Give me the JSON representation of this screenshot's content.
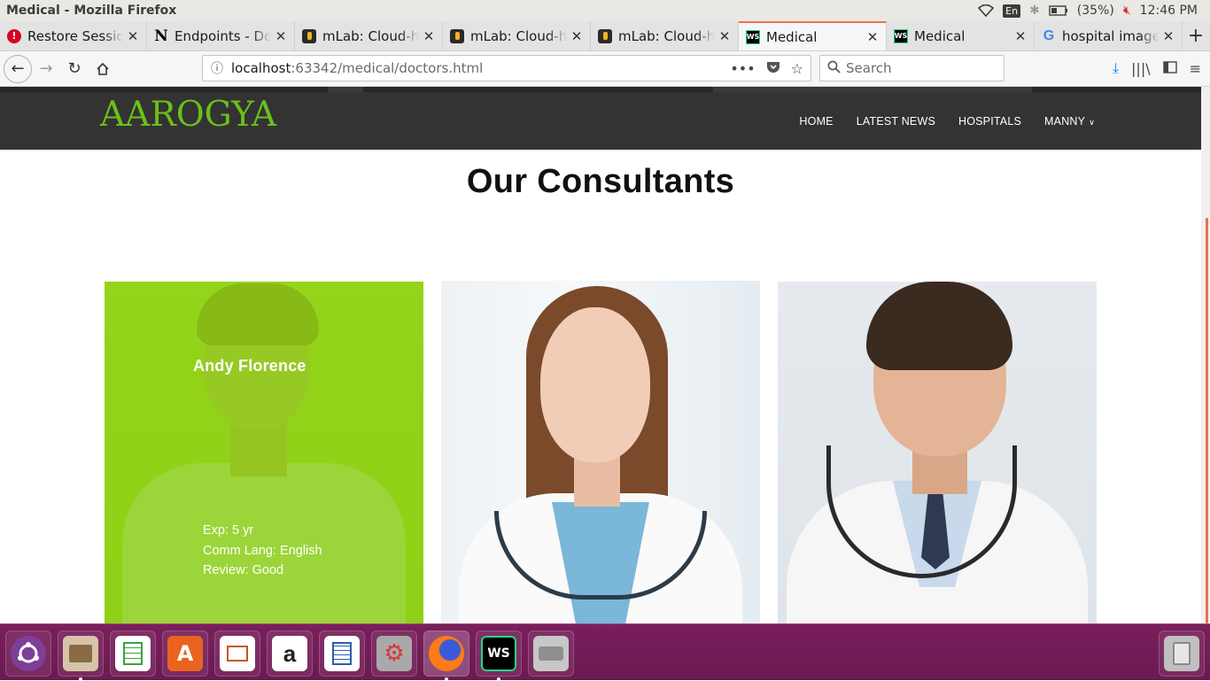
{
  "os": {
    "window_title": "Medical - Mozilla Firefox",
    "keyboard": "En",
    "battery": "(35%)",
    "clock": "12:46 PM"
  },
  "tabs": [
    {
      "label": "Restore Session",
      "favicon": "alert-icon"
    },
    {
      "label": "Endpoints - Doc",
      "favicon": "notion-icon"
    },
    {
      "label": "mLab: Cloud-ho",
      "favicon": "mlab-icon"
    },
    {
      "label": "mLab: Cloud-ho",
      "favicon": "mlab-icon"
    },
    {
      "label": "mLab: Cloud-ho",
      "favicon": "mlab-icon"
    },
    {
      "label": "Medical",
      "favicon": "webstorm-icon",
      "active": true
    },
    {
      "label": "Medical",
      "favicon": "webstorm-icon"
    },
    {
      "label": "hospital image",
      "favicon": "google-icon"
    }
  ],
  "nav": {
    "url_host": "localhost",
    "url_rest": ":63342/medical/doctors.html",
    "search_placeholder": "Search"
  },
  "site": {
    "brand": "AAROGYA",
    "menu": [
      "HOME",
      "LATEST NEWS",
      "HOSPITALS",
      "MANNY"
    ],
    "section_title": "Our Consultants"
  },
  "doctors": [
    {
      "name": "Andy Florence",
      "exp": "Exp: 5 yr",
      "lang": "Comm Lang: English",
      "review": "Review: Good"
    }
  ],
  "colors": {
    "brand_green": "#6abf1a",
    "header_bg": "#333333",
    "overlay_green": "#8cd214",
    "dock_bg": "#6b1a52",
    "active_tab_accent": "#e8714a"
  },
  "dock": [
    "ubuntu-icon",
    "files-icon",
    "spreadsheet-icon",
    "software-center-icon",
    "presentation-icon",
    "amazon-icon",
    "writer-icon",
    "settings-icon",
    "firefox-icon",
    "webstorm-icon",
    "disk-icon",
    "trash-icon"
  ]
}
